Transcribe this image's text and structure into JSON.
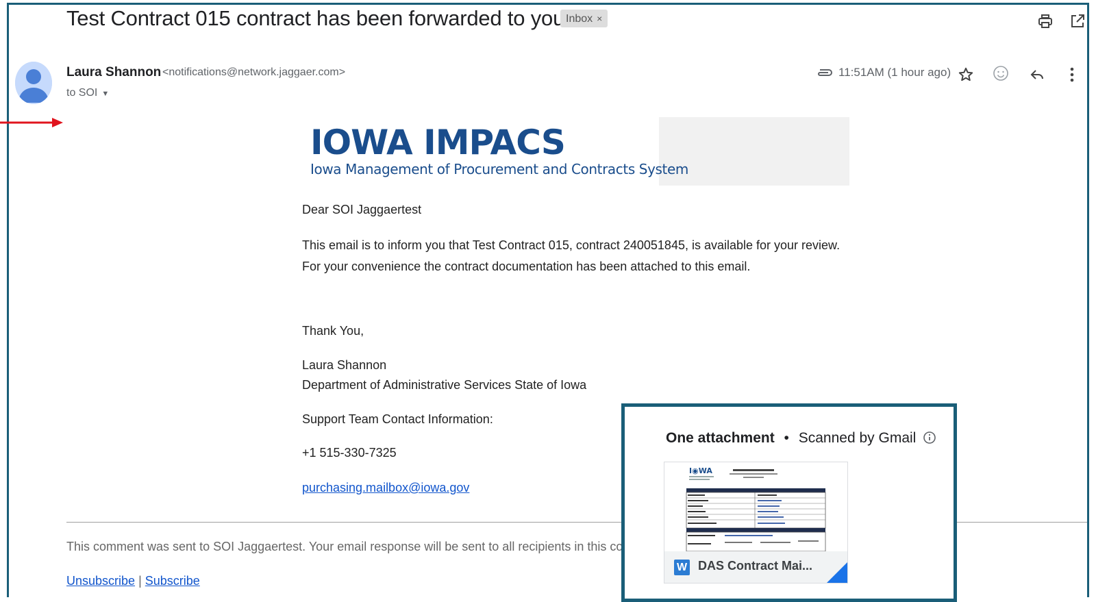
{
  "header": {
    "subject": "Test Contract 015 contract has been forwarded to you",
    "label_chip": "Inbox",
    "label_chip_close": "×"
  },
  "sender": {
    "name": "Laura Shannon",
    "email": "<notifications@network.jaggaer.com>",
    "to_line": "to SOI"
  },
  "meta": {
    "timestamp": "11:51AM (1 hour ago)"
  },
  "banner": {
    "logo_main": "IOWA IMPACS",
    "logo_sub": "Iowa Management of Procurement and Contracts System"
  },
  "message": {
    "greeting": "Dear SOI Jaggaertest",
    "paragraph": "This email is to inform you that Test Contract 015, contract 240051845, is available for your review. For your convenience the contract documentation has been attached to this email.",
    "thanks": "Thank You,",
    "signature_name": "Laura Shannon",
    "signature_dept": "Department of Administrative Services State of Iowa",
    "support_label": "Support Team Contact Information:",
    "phone": "+1 515-330-7325",
    "support_email": "purchasing.mailbox@iowa.gov"
  },
  "footer": {
    "note": "This comment was sent to SOI Jaggaertest. Your email response will be sent to all recipients in this conver",
    "unsubscribe": "Unsubscribe",
    "separator": "|",
    "subscribe": "Subscribe"
  },
  "attachments": {
    "heading": "One attachment",
    "bullet": "•",
    "scanned": "Scanned by Gmail",
    "file_name": "DAS Contract Mai..."
  },
  "colors": {
    "frame": "#1a5e78",
    "logo_blue": "#1a4d8c",
    "link": "#1155cc",
    "arrow": "#e0141e",
    "word_blue": "#2b7cd3"
  }
}
